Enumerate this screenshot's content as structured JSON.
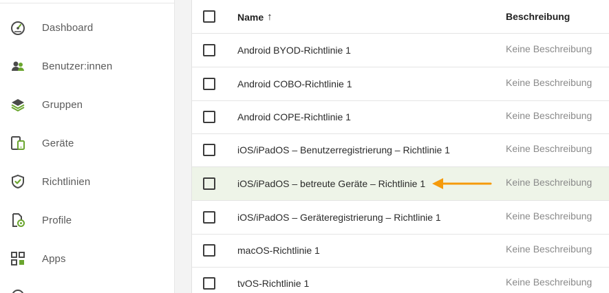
{
  "sidebar": {
    "items": [
      {
        "label": "Dashboard",
        "icon": "dashboard-gauge-icon"
      },
      {
        "label": "Benutzer:innen",
        "icon": "users-icon"
      },
      {
        "label": "Gruppen",
        "icon": "layers-icon"
      },
      {
        "label": "Geräte",
        "icon": "devices-icon"
      },
      {
        "label": "Richtlinien",
        "icon": "shield-check-icon"
      },
      {
        "label": "Profile",
        "icon": "profile-settings-icon"
      },
      {
        "label": "Apps",
        "icon": "apps-grid-icon"
      }
    ]
  },
  "table": {
    "headers": {
      "name": "Name",
      "description": "Beschreibung"
    },
    "sort_indicator": "↑",
    "rows": [
      {
        "name": "Android BYOD-Richtlinie 1",
        "description": "Keine Beschreibung"
      },
      {
        "name": "Android COBO-Richtlinie 1",
        "description": "Keine Beschreibung"
      },
      {
        "name": "Android COPE-Richtlinie 1",
        "description": "Keine Beschreibung"
      },
      {
        "name": "iOS/iPadOS – Benutzerregistrierung – Richtlinie 1",
        "description": "Keine Beschreibung"
      },
      {
        "name": "iOS/iPadOS – betreute Geräte – Richtlinie 1",
        "description": "Keine Beschreibung",
        "highlighted": true
      },
      {
        "name": "iOS/iPadOS – Geräteregistrierung – Richtlinie 1",
        "description": "Keine Beschreibung"
      },
      {
        "name": "macOS-Richtlinie 1",
        "description": "Keine Beschreibung"
      },
      {
        "name": "tvOS-Richtlinie 1",
        "description": "Keine Beschreibung"
      }
    ]
  },
  "colors": {
    "accent_green": "#6aa52e",
    "icon_gray": "#4a4a4a",
    "highlight_row": "#eef4e8",
    "annotation_arrow": "#f59a0b"
  }
}
